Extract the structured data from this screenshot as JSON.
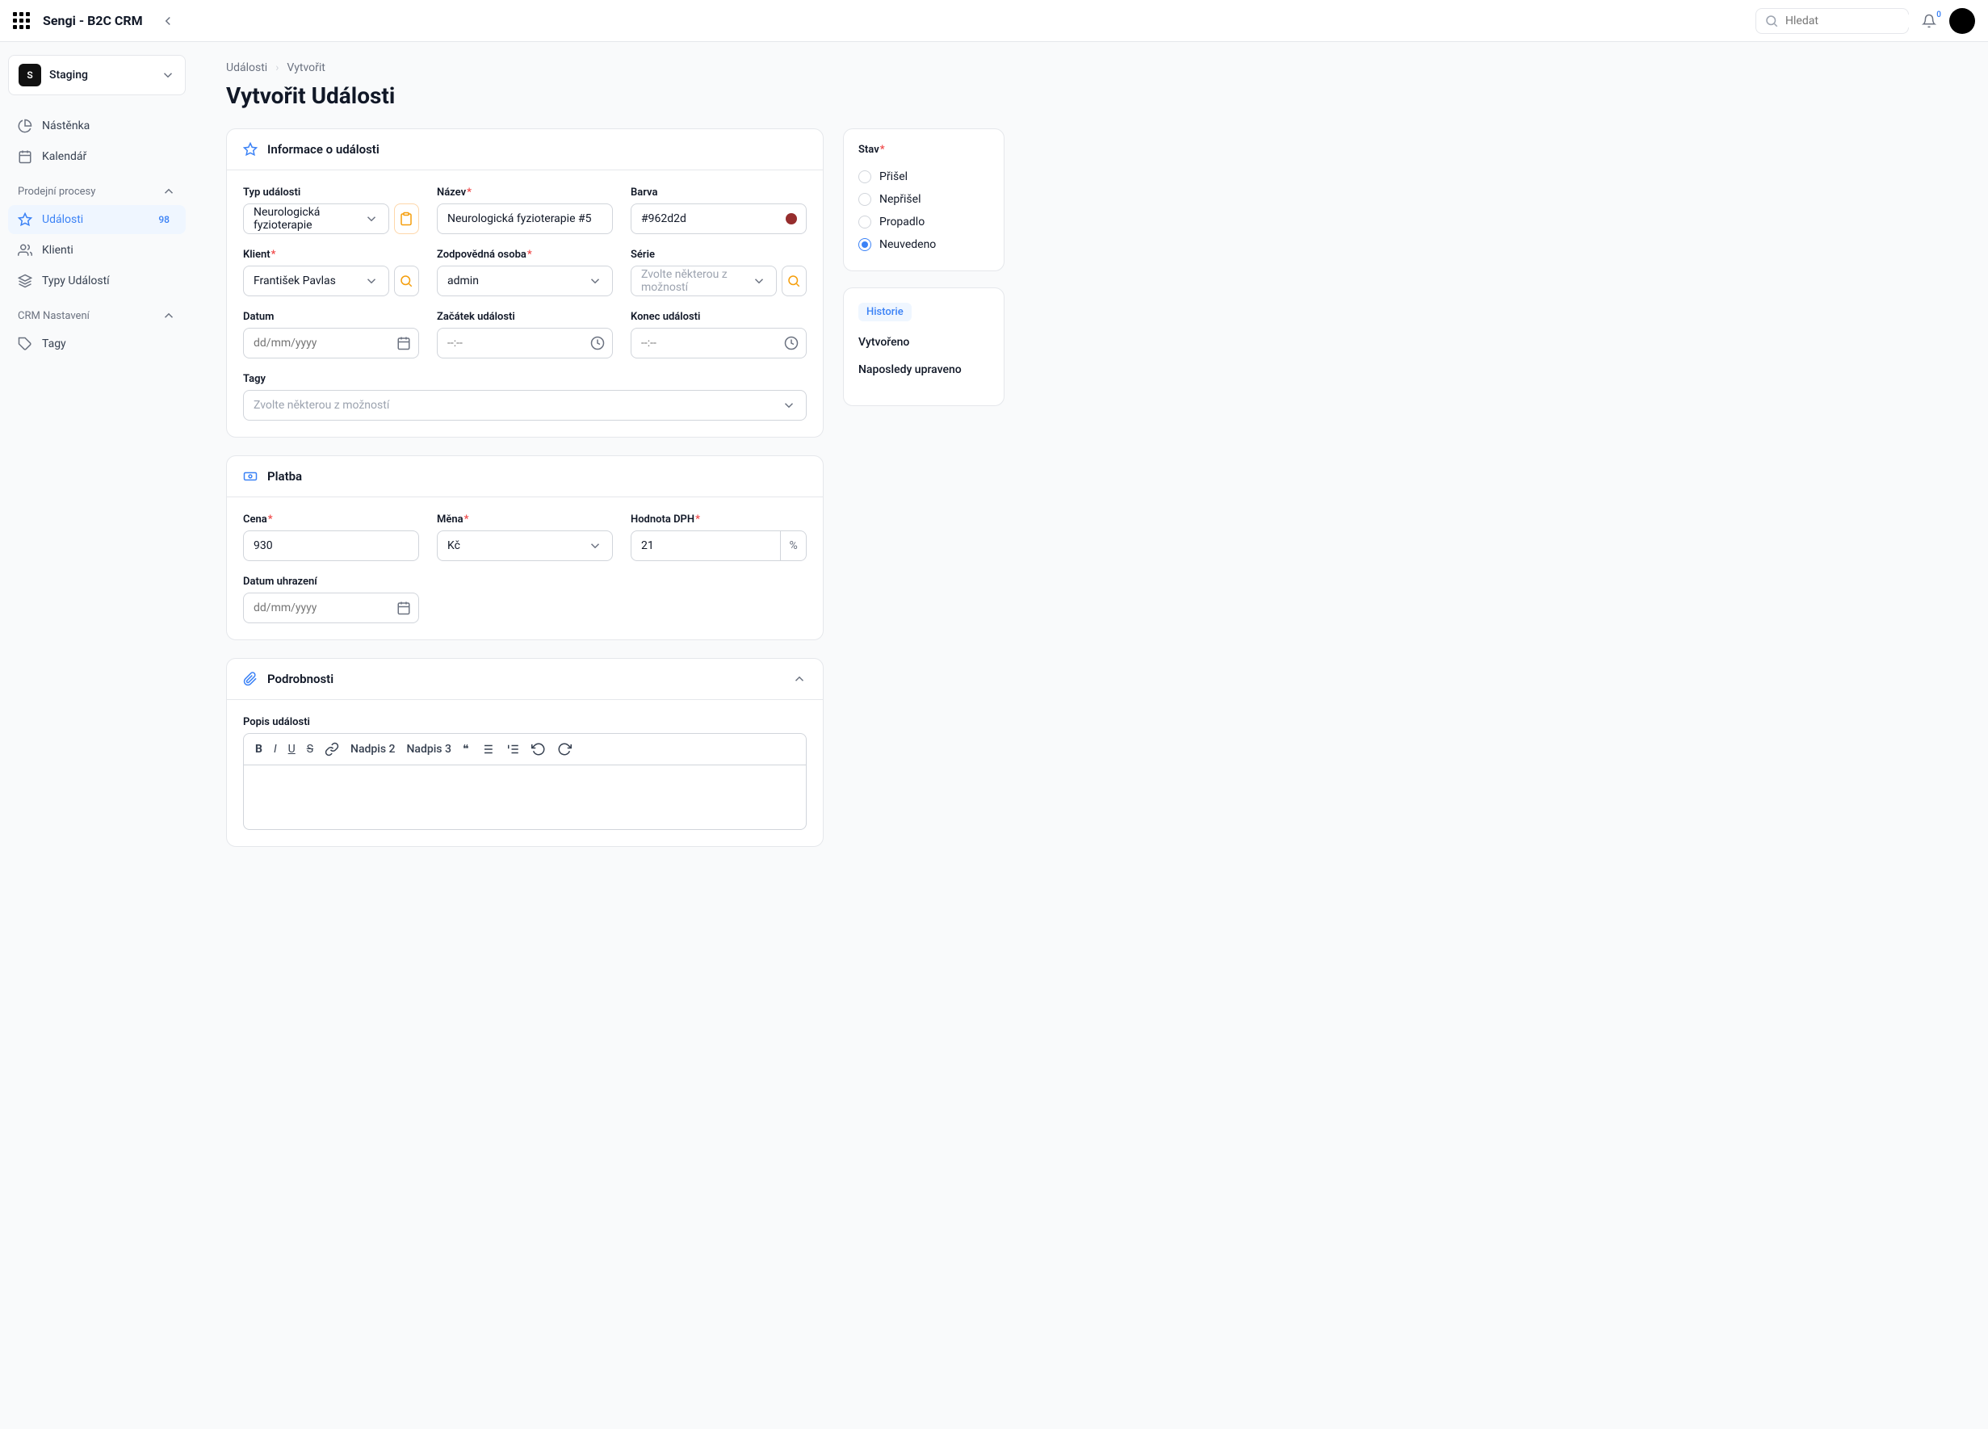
{
  "app_title": "Sengi - B2C CRM",
  "search_placeholder": "Hledat",
  "bell_count": "0",
  "space": {
    "letter": "S",
    "name": "Staging"
  },
  "nav": {
    "dashboard": "Nástěnka",
    "calendar": "Kalendář",
    "sec_sales": "Prodejní procesy",
    "events": "Události",
    "events_badge": "98",
    "clients": "Klienti",
    "event_types": "Typy Událostí",
    "sec_settings": "CRM Nastavení",
    "tags": "Tagy"
  },
  "breadcrumb": {
    "a": "Události",
    "b": "Vytvořit"
  },
  "page_title": "Vytvořit Události",
  "section_info": "Informace o události",
  "section_payment": "Platba",
  "section_details": "Podrobnosti",
  "fields": {
    "event_type_label": "Typ události",
    "event_type_value": "Neurologická fyzioterapie",
    "name_label": "Název",
    "name_value": "Neurologická fyzioterapie #5",
    "color_label": "Barva",
    "color_value": "#962d2d",
    "client_label": "Klient",
    "client_value": "František Pavlas",
    "responsible_label": "Zodpovědná osoba",
    "responsible_value": "admin",
    "series_label": "Série",
    "series_placeholder": "Zvolte některou z možností",
    "date_label": "Datum",
    "date_placeholder": "dd/mm/yyyy",
    "start_label": "Začátek události",
    "time_placeholder": "--:--",
    "end_label": "Konec události",
    "tags_label": "Tagy",
    "tags_placeholder": "Zvolte některou z možností",
    "price_label": "Cena",
    "price_value": "930",
    "currency_label": "Měna",
    "currency_value": "Kč",
    "vat_label": "Hodnota DPH",
    "vat_value": "21",
    "vat_suffix": "%",
    "paid_date_label": "Datum uhrazení",
    "description_label": "Popis události"
  },
  "editor": {
    "h2": "Nadpis 2",
    "h3": "Nadpis 3"
  },
  "state": {
    "label": "Stav",
    "opts": {
      "came": "Přišel",
      "nocame": "Nepřišel",
      "lapsed": "Propadlo",
      "none": "Neuvedeno"
    }
  },
  "history": {
    "tab": "Historie",
    "created": "Vytvořeno",
    "updated": "Naposledy upraveno"
  }
}
